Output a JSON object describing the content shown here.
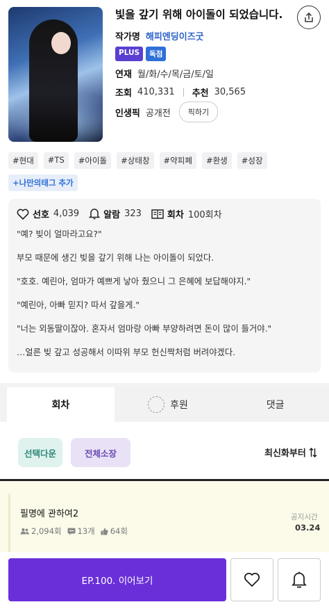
{
  "novel": {
    "title": "빛을 갚기 위해 아이돌이 되었습니다.",
    "author_label": "작가명",
    "author": "해피엔딩이즈굿",
    "badges": [
      "PLUS",
      "독점"
    ],
    "serial_label": "연재",
    "serial_days": "월/화/수/목/금/토/일",
    "views_label": "조회",
    "views": "410,331",
    "recommend_label": "추천",
    "recommend": "30,565",
    "pick_label": "인생픽",
    "pick_status": "공개전",
    "pick_button": "픽하기"
  },
  "tags": [
    "#현대",
    "#TS",
    "#아이돌",
    "#상태창",
    "#약피폐",
    "#환생",
    "#성장"
  ],
  "add_tag": "+나만의태그 추가",
  "synopsis": {
    "favorite_label": "선호",
    "favorite_count": "4,039",
    "alarm_label": "알람",
    "alarm_count": "323",
    "episodes_label": "회차",
    "episodes_count": "100회차",
    "lines": [
      "\"예? 빚이 얼마라고요?\"",
      "부모 때문에 생긴 빚을 갚기 위해 나는 아이돌이 되었다.",
      "\"호호. 예린아, 엄마가 예쁘게 낳아 줬으니 그 은혜에 보답해야지.\"",
      "\"예린아, 아빠 믿지? 따서 갚을게.\"",
      "\"너는 외동딸이잖아. 혼자서 엄마랑 아빠 부양하려면 돈이 많이 들거야.\"",
      "…얼른 빚 갚고 성공해서 이따위 부모 헌신짝처럼 버려야겠다."
    ]
  },
  "tabs": {
    "episodes": "회차",
    "support": "후원",
    "comments": "댓글"
  },
  "chips": {
    "select_download": "선택다운",
    "collect_all": "전체소장",
    "sort": "최신화부터"
  },
  "notice": {
    "title": "필명에 관하여2",
    "readers": "2,094회",
    "comments": "13개",
    "likes": "64회",
    "time_label": "공지시간",
    "time": "03.24"
  },
  "bottom": {
    "continue": "EP.100. 이어보기"
  },
  "colors": {
    "accent": "#6a2fd9",
    "author_link": "#2e64c7",
    "plus_badge": "#5b3fd2",
    "exclusive_badge": "#2f6fd8"
  }
}
